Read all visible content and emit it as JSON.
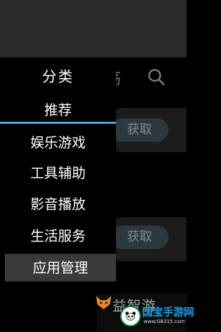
{
  "background": {
    "tab_partial_char": "荡",
    "get_buttons": [
      "获取",
      "获取"
    ],
    "bottom_partial_text": "益智游"
  },
  "drawer": {
    "title": "分类",
    "selected_tab": "推荐",
    "items": [
      "娱乐游戏",
      "工具辅助",
      "影音播放",
      "生活服务",
      "应用管理"
    ],
    "active_index": 4
  },
  "watermark": {
    "text": "国宝手游网",
    "url": "www.GB315.com"
  },
  "colors": {
    "accent": "#4fa8df",
    "drawer_bg": "#000000",
    "active_item_bg": "#3a3a3a",
    "status_bar_bg": "#2a2a2a"
  }
}
